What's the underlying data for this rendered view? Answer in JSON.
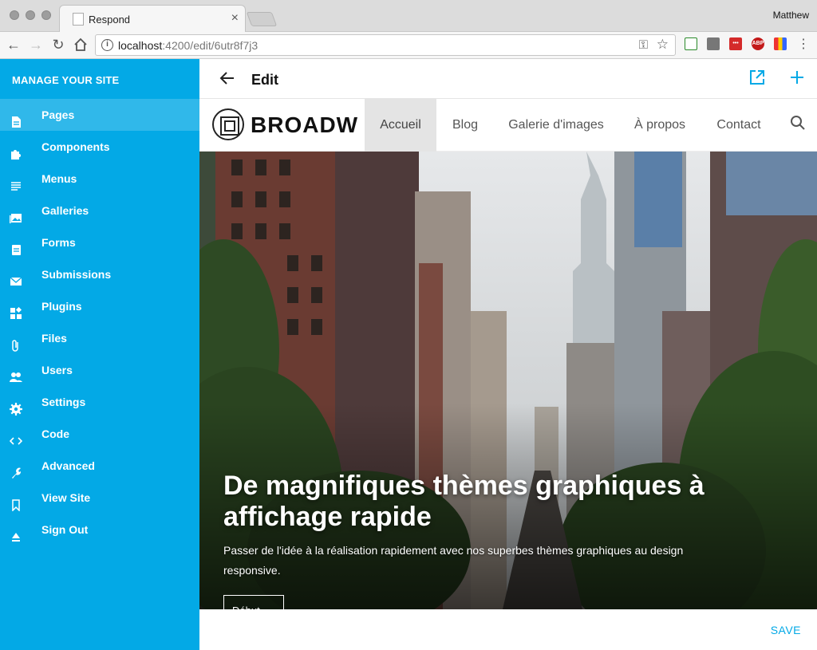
{
  "browser": {
    "tab_title": "Respond",
    "profile_name": "Matthew",
    "url_host": "localhost",
    "url_path": ":4200/edit/6utr8f7j3",
    "extensions": [
      {
        "name": "sheets-ext-icon",
        "color": "#d42a2a",
        "label": "•••"
      },
      {
        "name": "adblock-icon",
        "color": "#c31a1a",
        "label": "ABP"
      },
      {
        "name": "colorful-ext-icon",
        "color": "#5865e0",
        "label": ""
      }
    ]
  },
  "sidebar": {
    "title": "MANAGE YOUR SITE",
    "items": [
      {
        "label": "Pages",
        "icon": "page-icon"
      },
      {
        "label": "Components",
        "icon": "puzzle-icon"
      },
      {
        "label": "Menus",
        "icon": "menu-lines-icon"
      },
      {
        "label": "Galleries",
        "icon": "image-icon"
      },
      {
        "label": "Forms",
        "icon": "clipboard-icon"
      },
      {
        "label": "Submissions",
        "icon": "mail-icon"
      },
      {
        "label": "Plugins",
        "icon": "widgets-icon"
      },
      {
        "label": "Files",
        "icon": "paperclip-icon"
      },
      {
        "label": "Users",
        "icon": "users-icon"
      },
      {
        "label": "Settings",
        "icon": "gear-icon"
      },
      {
        "label": "Code",
        "icon": "code-icon"
      },
      {
        "label": "Advanced",
        "icon": "wrench-icon"
      },
      {
        "label": "View Site",
        "icon": "bookmark-icon"
      },
      {
        "label": "Sign Out",
        "icon": "eject-icon"
      }
    ],
    "active_index": 0
  },
  "header": {
    "title": "Edit"
  },
  "site": {
    "logo_text": "BROADW",
    "menu": [
      {
        "label": "Accueil"
      },
      {
        "label": "Blog"
      },
      {
        "label": "Galerie d'images"
      },
      {
        "label": "À propos"
      },
      {
        "label": "Contact"
      }
    ],
    "active_menu_index": 0
  },
  "hero": {
    "title": "De magnifiques thèmes graphiques à affichage rapide",
    "subtitle": "Passer de l'idée à la réalisation rapidement avec nos superbes thèmes graphiques au design responsive.",
    "button_label": "Début"
  },
  "footer": {
    "save_label": "SAVE"
  },
  "colors": {
    "accent": "#03a9e6"
  }
}
